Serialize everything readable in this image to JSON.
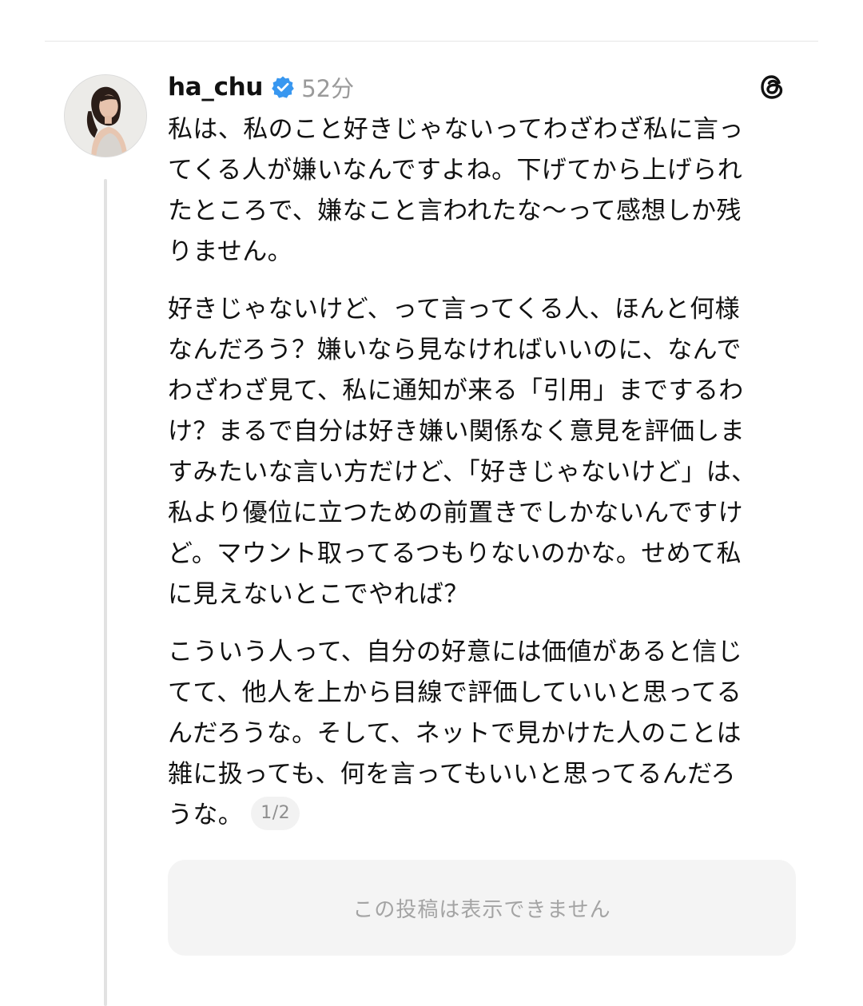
{
  "post": {
    "username": "ha_chu",
    "verified": true,
    "time": "52分",
    "icons": {
      "avatar": "profile-photo",
      "verified": "verified-badge-icon",
      "app": "threads-logo-icon"
    },
    "colors": {
      "verified_badge": "#3897f0",
      "time": "#9a9a9a",
      "text": "#111111"
    },
    "paragraphs": [
      [
        "私は、私のこと好きじゃないってわざわざ私に言っ",
        "てくる人が嫌いなんですよね。下げてから上げられ",
        "たところで、嫌なこと言われたな〜って感想しか残",
        "りません。"
      ],
      [
        "好きじゃないけど、って言ってくる人、ほんと何様",
        "なんだろう？嫌いなら見なければいいのに、なんで",
        "わざわざ見て、私に通知が来る「引用」までするわ",
        "け？まるで自分は好き嫌い関係なく意見を評価しま",
        "すみたいな言い方だけど、「好きじゃないけど」は、",
        "私より優位に立つための前置きでしかないんですけ",
        "ど。マウント取ってるつもりないのかな。せめて私",
        "に見えないとこでやれば？"
      ],
      [
        "こういう人って、自分の好意には価値があると信じ",
        "てて、他人を上から目線で評価していいと思ってる",
        "んだろうな。そして、ネットで見かけた人のことは",
        "雑に扱っても、何を言ってもいいと思ってるんだろ",
        "うな。"
      ]
    ],
    "page_indicator": "1/2"
  },
  "quoted_post": {
    "unavailable_text": "この投稿は表示できません"
  }
}
